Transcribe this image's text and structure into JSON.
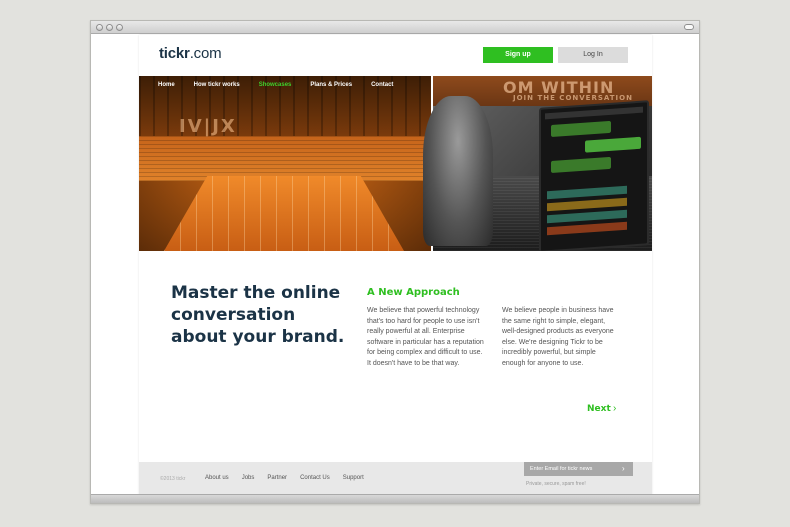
{
  "brand": {
    "name_bold": "tickr",
    "name_rest": ".com"
  },
  "header": {
    "signup_label": "Sign up",
    "login_label": "Log In"
  },
  "nav": {
    "items": [
      {
        "label": "Home",
        "active": false
      },
      {
        "label": "How tickr works",
        "active": false
      },
      {
        "label": "Showcases",
        "active": true
      },
      {
        "label": "Plans & Prices",
        "active": false
      },
      {
        "label": "Contact",
        "active": false
      }
    ]
  },
  "hero": {
    "banner_text": "OM WITHIN",
    "banner_sub": "JOIN THE CONVERSATION",
    "scoreboard": "IV|JX"
  },
  "main": {
    "headline": "Master the online conversation about your brand.",
    "sub_title": "A New Approach",
    "col1": "We believe that powerful technology that's too hard for people to use isn't really powerful at all. Enterprise software in particular has a reputation for being complex and difficult to use. It doesn't have to be that way.",
    "col2": "We believe people in business have the same right to simple, elegant, well-designed products as everyone else. We're designing Tickr to be incredibly powerful, but simple enough for anyone to use.",
    "next_label": "Next",
    "next_chevron": "›"
  },
  "footer": {
    "copyright": "©2013 tickr",
    "links": [
      "About us",
      "Jobs",
      "Partner",
      "Contact Us",
      "Support"
    ],
    "email_placeholder": "Enter Email for tickr news",
    "email_arrow": "›",
    "privacy": "Private, secure, spam free!"
  },
  "colors": {
    "accent": "#2fbf21",
    "brand": "#1b3346",
    "hero_tint": "#e07a1e"
  }
}
